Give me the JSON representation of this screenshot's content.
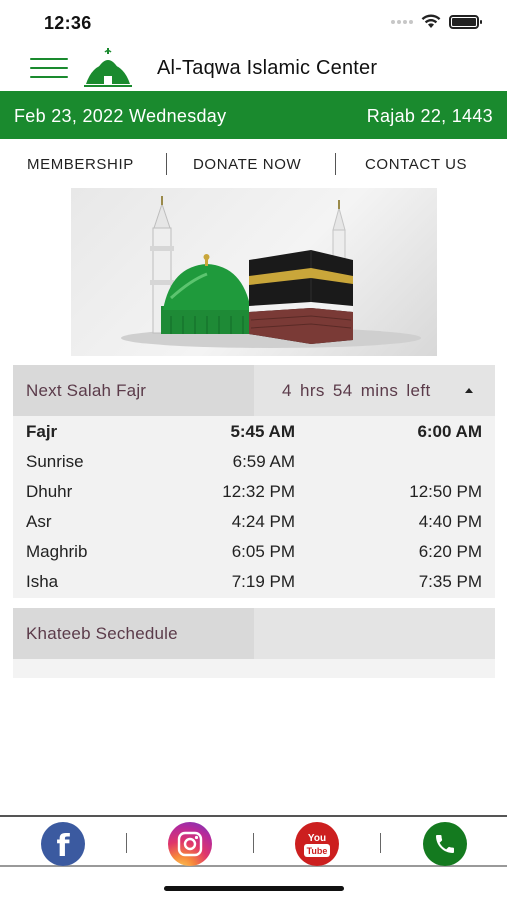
{
  "status_bar": {
    "time": "12:36"
  },
  "header": {
    "title": "Al-Taqwa Islamic Center",
    "menu_icon": "hamburger-icon",
    "logo_icon": "mosque-logo-icon"
  },
  "date_bar": {
    "gregorian": "Feb 23, 2022 Wednesday",
    "hijri": "Rajab 22, 1443"
  },
  "nav": {
    "membership": "MEMBERSHIP",
    "donate": "DONATE NOW",
    "contact": "CONTACT US"
  },
  "prayer_panel": {
    "next_salah_label": "Next Salah Fajr",
    "time_left": "4 hrs  54 mins  left",
    "rows": [
      {
        "name": "Fajr",
        "adhan": "5:45 AM",
        "iqamah": "6:00 AM"
      },
      {
        "name": "Sunrise",
        "adhan": "6:59 AM",
        "iqamah": ""
      },
      {
        "name": "Dhuhr",
        "adhan": "12:32 PM",
        "iqamah": "12:50 PM"
      },
      {
        "name": "Asr",
        "adhan": "4:24 PM",
        "iqamah": "4:40 PM"
      },
      {
        "name": "Maghrib",
        "adhan": "6:05 PM",
        "iqamah": "6:20 PM"
      },
      {
        "name": "Isha",
        "adhan": "7:19 PM",
        "iqamah": "7:35 PM"
      }
    ]
  },
  "khateeb": {
    "label": "Khateeb Sechedule"
  },
  "footer": {
    "facebook_glyph": "f",
    "youtube_top": "You",
    "youtube_bottom": "Tube",
    "icons": [
      "facebook-icon",
      "instagram-icon",
      "youtube-icon",
      "phone-icon"
    ]
  },
  "colors": {
    "brand_green": "#1a8a2e",
    "label_mauve": "#5b3b4a",
    "facebook_blue": "#3b5aa0",
    "youtube_red": "#cc1f1f",
    "phone_green": "#147a1f"
  }
}
